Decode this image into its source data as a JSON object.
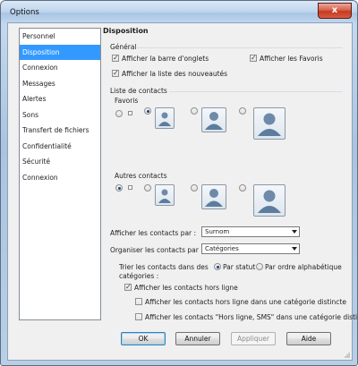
{
  "window": {
    "title": "Options",
    "close_glyph": "x"
  },
  "sidebar": {
    "items": [
      {
        "label": "Personnel",
        "selected": false
      },
      {
        "label": "Disposition",
        "selected": true
      },
      {
        "label": "Connexion",
        "selected": false
      },
      {
        "label": "Messages",
        "selected": false
      },
      {
        "label": "Alertes",
        "selected": false
      },
      {
        "label": "Sons",
        "selected": false
      },
      {
        "label": "Transfert de fichiers",
        "selected": false
      },
      {
        "label": "Confidentialité",
        "selected": false
      },
      {
        "label": "Sécurité",
        "selected": false
      },
      {
        "label": "Connexion",
        "selected": false
      }
    ]
  },
  "panel": {
    "title": "Disposition",
    "general": {
      "heading": "Général",
      "tab_bar": {
        "label": "Afficher la barre d'onglets",
        "checked": true
      },
      "favorites": {
        "label": "Afficher les Favoris",
        "checked": true
      },
      "whats_new": {
        "label": "Afficher la liste des nouveautés",
        "checked": true
      }
    },
    "contact_list": {
      "heading": "Liste de contacts",
      "favorites_label": "Favoris",
      "favorites_selected_size": 2,
      "others_label": "Autres contacts",
      "others_selected_size": 1
    },
    "show_contacts": {
      "label": "Afficher les contacts par :",
      "value": "Surnom"
    },
    "organize_contacts": {
      "label": "Organiser les contacts par :",
      "value": "Catégories"
    },
    "sort": {
      "label_line1": "Trier les contacts dans des",
      "label_line2": "catégories :",
      "by_status": {
        "label": "Par statut",
        "selected": true
      },
      "alphabetical": {
        "label": "Par ordre alphabétique",
        "selected": false
      }
    },
    "offline": {
      "label": "Afficher les contacts hors ligne",
      "checked": true
    },
    "offline_separate": {
      "label": "Afficher les contacts hors ligne dans une catégorie distincte",
      "checked": false
    },
    "offline_sms_separate": {
      "label": "Afficher les contacts \"Hors ligne, SMS\" dans une catégorie distincte",
      "checked": false
    }
  },
  "buttons": {
    "ok": "OK",
    "cancel": "Annuler",
    "apply": "Appliquer",
    "help": "Aide"
  },
  "check_glyph": "✓",
  "colors": {
    "selection": "#3399ff",
    "close_red": "#c53a22",
    "default_button_border": "#3c7fb1"
  }
}
